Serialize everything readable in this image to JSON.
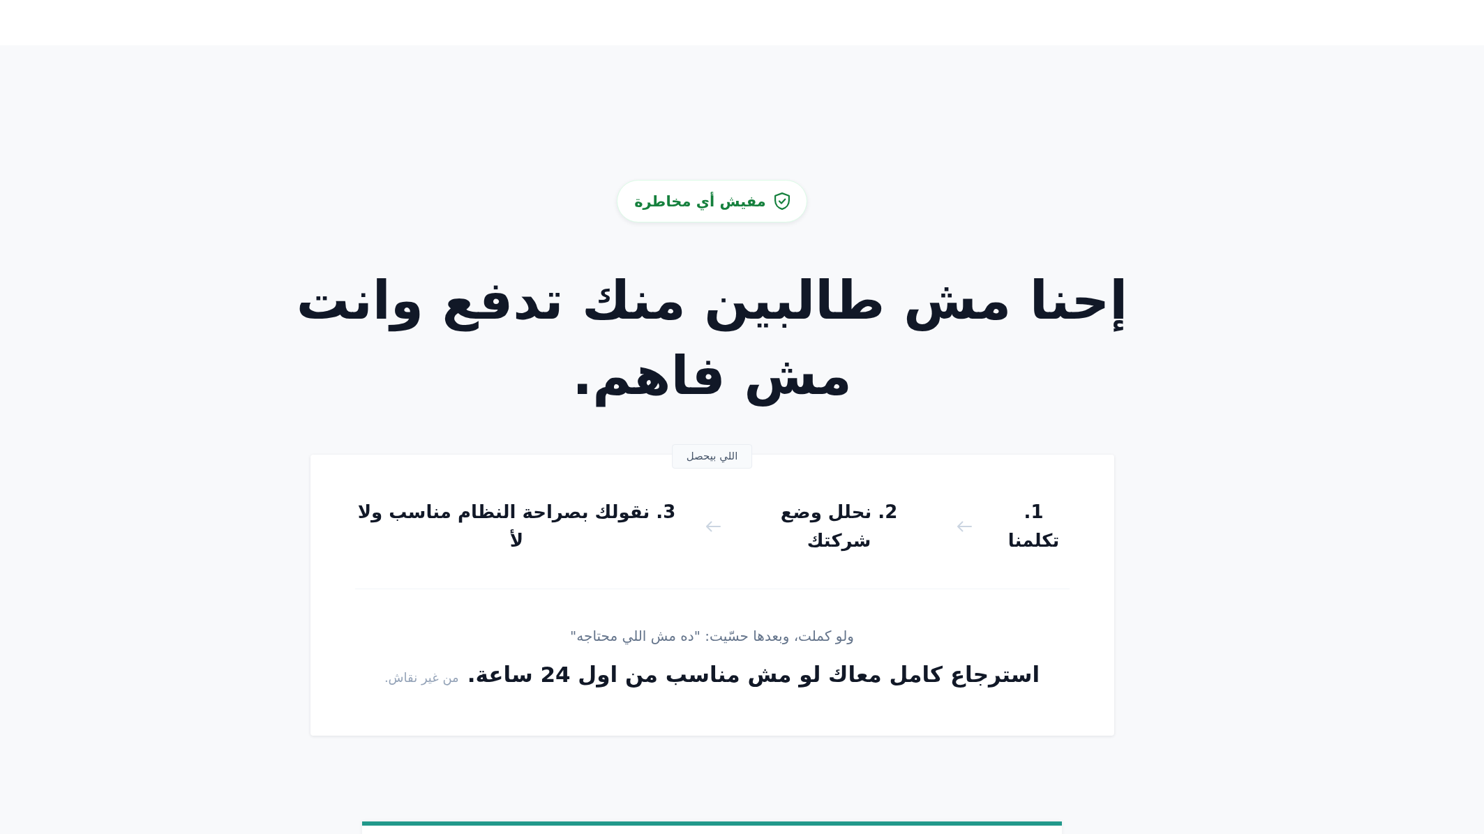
{
  "badge": {
    "label": "مفيش أي مخاطرة"
  },
  "heading": "إحنا مش طالبين منك تدفع وانت مش فاهم.",
  "process_card": {
    "tag": "اللي بيحصل",
    "steps": [
      {
        "label": "1. تكلمنا"
      },
      {
        "label": "2. نحلل وضع شركتك"
      },
      {
        "label": "3. نقولك بصراحة النظام مناسب ولا لأ"
      }
    ],
    "subtext": "ولو كملت، وبعدها حسّيت: \"ده مش اللي محتاجه\"",
    "guarantee": "استرجاع كامل معاك لو مش مناسب من اول 24 ساعة.",
    "guarantee_note": "من غير نقاش."
  }
}
